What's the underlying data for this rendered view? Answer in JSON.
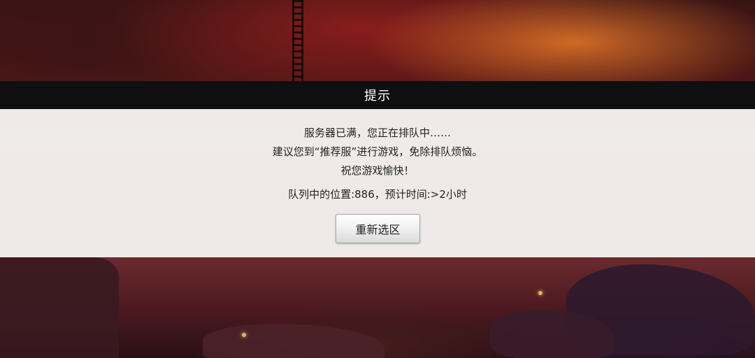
{
  "dialog": {
    "title": "提示",
    "line1": "服务器已满，您正在排队中……",
    "line2": "建议您到“推荐服”进行游戏，免除排队烦恼。",
    "line3": "祝您游戏愉快！",
    "queue_info": "队列中的位置:886，预计时间:>2小时",
    "reselect_button_label": "重新选区"
  }
}
